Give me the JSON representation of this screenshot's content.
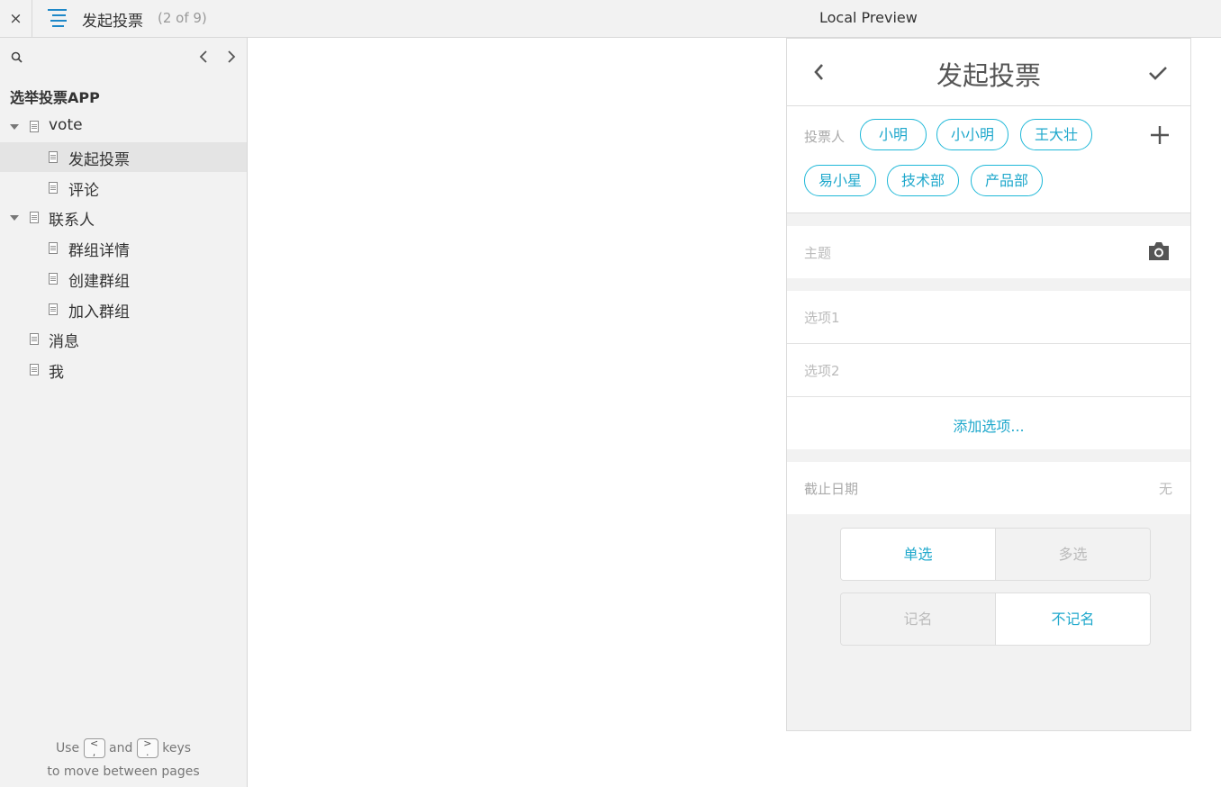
{
  "topbar": {
    "close": "×",
    "page_title": "发起投票",
    "page_count": "(2 of 9)",
    "preview_label": "Local Preview"
  },
  "sidebar": {
    "project": "选举投票APP",
    "tree": [
      {
        "label": "vote",
        "level": 0,
        "expanded": true
      },
      {
        "label": "发起投票",
        "level": 1,
        "active": true
      },
      {
        "label": "评论",
        "level": 1
      },
      {
        "label": "联系人",
        "level": 0,
        "expanded": true
      },
      {
        "label": "群组详情",
        "level": 1
      },
      {
        "label": "创建群组",
        "level": 1
      },
      {
        "label": "加入群组",
        "level": 1
      },
      {
        "label": "消息",
        "level": 0
      },
      {
        "label": "我",
        "level": 0
      }
    ],
    "hint": {
      "use": "Use",
      "key_prev": "<\n,",
      "and": "and",
      "key_next": ">\n.",
      "keys": "keys",
      "line2": "to move between pages"
    }
  },
  "phone": {
    "title": "发起投票",
    "voters_label": "投票人",
    "voters": [
      "小明",
      "小小明",
      "王大壮",
      "易小星",
      "技术部",
      "产品部"
    ],
    "subject_placeholder": "主题",
    "option1_placeholder": "选项1",
    "option2_placeholder": "选项2",
    "add_option": "添加选项...",
    "deadline_label": "截止日期",
    "deadline_value": "无",
    "choice": {
      "single": "单选",
      "multi": "多选",
      "selected": "single"
    },
    "naming": {
      "named": "记名",
      "anonymous": "不记名",
      "selected": "anonymous"
    }
  },
  "colors": {
    "accent": "#1fa8cc",
    "menu_icon": "#1e88c8"
  },
  "icons": [
    "close-icon",
    "menu-icon",
    "search-icon",
    "chevron-left-icon",
    "chevron-right-icon",
    "page-icon",
    "back-icon",
    "check-icon",
    "plus-icon",
    "camera-icon"
  ]
}
